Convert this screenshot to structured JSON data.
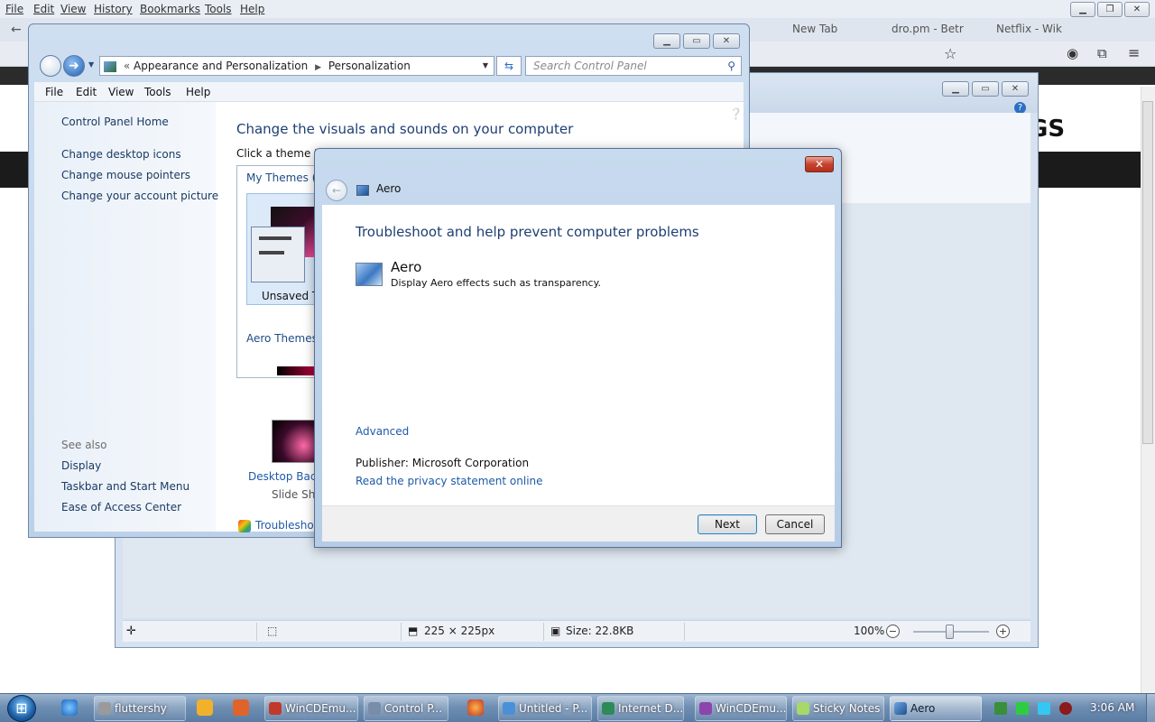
{
  "firefox": {
    "menu": [
      "File",
      "Edit",
      "View",
      "History",
      "Bookmarks",
      "Tools",
      "Help"
    ],
    "tabs": [
      "New Tab",
      "dro.pm - Betr",
      "Netflix - Wik"
    ],
    "page_heading": "GS"
  },
  "viewer": {
    "status": {
      "dimensions": "225 × 225px",
      "size": "Size: 22.8KB",
      "zoom": "100%"
    }
  },
  "control_panel": {
    "breadcrumb": [
      "Appearance and Personalization",
      "Personalization"
    ],
    "search_placeholder": "Search Control Panel",
    "menu": [
      "File",
      "Edit",
      "View",
      "Tools",
      "Help"
    ],
    "left_nav": {
      "home": "Control Panel Home",
      "links": [
        "Change desktop icons",
        "Change mouse pointers",
        "Change your account picture"
      ],
      "see_also_label": "See also",
      "see_also": [
        "Display",
        "Taskbar and Start Menu",
        "Ease of Access Center"
      ]
    },
    "main": {
      "title": "Change the visuals and sounds on your computer",
      "instruction": "Click a theme to",
      "my_themes": "My Themes (1",
      "unsaved_theme": "Unsaved T",
      "aero_themes": "Aero Themes (",
      "desktop_background": "Desktop Backg",
      "desktop_background_sub": "Slide Sho",
      "troubleshoot": "Troubleshoot"
    }
  },
  "dialog": {
    "title": "Aero",
    "heading": "Troubleshoot and help prevent computer problems",
    "item_title": "Aero",
    "item_desc": "Display Aero effects such as transparency.",
    "advanced": "Advanced",
    "publisher": "Publisher:  Microsoft Corporation",
    "privacy": "Read the privacy statement online",
    "next": "Next",
    "cancel": "Cancel"
  },
  "taskbar": {
    "items": [
      "fluttershy",
      "WinCDEmu...",
      "Control P...",
      "Untitled - P...",
      "Internet D...",
      "WinCDEmu...",
      "Sticky Notes",
      "Aero"
    ],
    "clock": "3:06 AM"
  }
}
